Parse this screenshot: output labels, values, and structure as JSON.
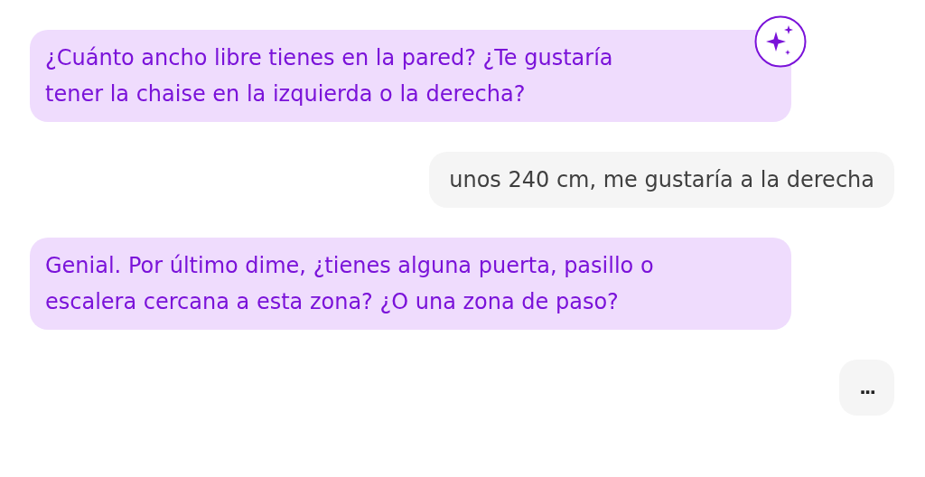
{
  "messages": [
    {
      "kind": "assistant",
      "text": "¿Cuánto ancho libre tienes en la pared? ¿Te gustaría tener la chaise en la izquierda o la derecha?",
      "badge": true
    },
    {
      "kind": "user",
      "text": "unos 240 cm, me gustaría a la derecha"
    },
    {
      "kind": "assistant",
      "text": "Genial. Por último dime, ¿tienes alguna puerta, pasillo o escalera cercana a esta zona? ¿O una zona de paso?",
      "badge": false
    }
  ],
  "typing_indicator": "..."
}
